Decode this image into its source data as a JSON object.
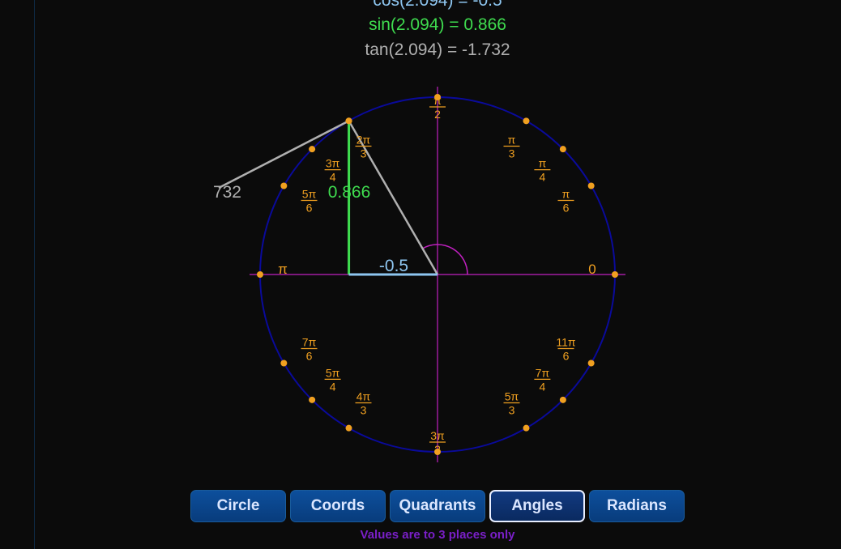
{
  "readouts": {
    "cos": "cos(2.094) = -0.5",
    "sin": "sin(2.094) = 0.866",
    "tan": "tan(2.094) = -1.732"
  },
  "selected_angle_rad": 2.094,
  "diagram": {
    "sin_label": "0.866",
    "cos_label": "-0.5",
    "tan_label": "732",
    "axis_labels": {
      "zero": "0",
      "pi": "π"
    },
    "angle_marks": [
      {
        "deg": 90,
        "num": "π",
        "den": "2"
      },
      {
        "deg": 60,
        "num": "π",
        "den": "3"
      },
      {
        "deg": 45,
        "num": "π",
        "den": "4"
      },
      {
        "deg": 30,
        "num": "π",
        "den": "6"
      },
      {
        "deg": 120,
        "num": "2π",
        "den": "3"
      },
      {
        "deg": 135,
        "num": "3π",
        "den": "4"
      },
      {
        "deg": 150,
        "num": "5π",
        "den": "6"
      },
      {
        "deg": 210,
        "num": "7π",
        "den": "6"
      },
      {
        "deg": 225,
        "num": "5π",
        "den": "4"
      },
      {
        "deg": 240,
        "num": "4π",
        "den": "3"
      },
      {
        "deg": 270,
        "num": "3π",
        "den": "2"
      },
      {
        "deg": 300,
        "num": "5π",
        "den": "3"
      },
      {
        "deg": 315,
        "num": "7π",
        "den": "4"
      },
      {
        "deg": 330,
        "num": "11π",
        "den": "6"
      }
    ],
    "colors": {
      "circle": "#0a0a9a",
      "axis": "#c020c0",
      "sin": "#3fdc4f",
      "cos": "#8ec6f0",
      "hyp": "#b0b0b0",
      "marks": "#f0a020"
    }
  },
  "tabs": [
    {
      "label": "Circle",
      "active": false
    },
    {
      "label": "Coords",
      "active": false
    },
    {
      "label": "Quadrants",
      "active": false
    },
    {
      "label": "Angles",
      "active": true
    },
    {
      "label": "Radians",
      "active": false
    }
  ],
  "footnote": "Values are to 3 places only"
}
